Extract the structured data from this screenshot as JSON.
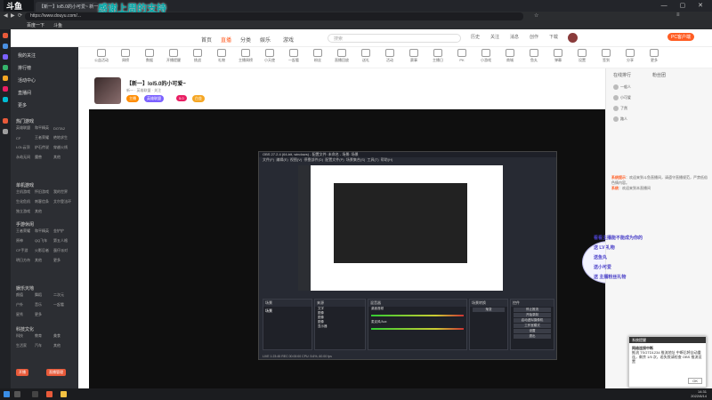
{
  "browser": {
    "brand": "斗鱼",
    "tabs": [
      {
        "label": "【新一】lol5.0的小可爱~ 新一..."
      },
      {
        "label": "新标签页"
      }
    ],
    "address": "https://www.douyu.com/...",
    "banner_text": "感谢上周的支持",
    "bookmarks": [
      "百度一下",
      "斗鱼"
    ]
  },
  "site": {
    "nav": [
      "首页",
      "直播",
      "分类",
      "娱乐",
      "游戏",
      "鱼吧"
    ],
    "active_nav": "直播",
    "search_placeholder": "搜索",
    "header_icons": [
      "历史",
      "关注",
      "消息",
      "创作",
      "下载",
      "开播"
    ],
    "categories": [
      "公益活动",
      "周榜",
      "数据",
      "开播提醒",
      "挑战",
      "礼物",
      "主播周榜",
      "小天使",
      "一起看",
      "粉丝",
      "直播回放",
      "送礼",
      "活动",
      "赛事",
      "主播日",
      "PK",
      "小游戏",
      "商城",
      "鱼丸",
      "弹幕",
      "设置",
      "签到",
      "分享",
      "更多"
    ],
    "pc_badge": "PC客户端",
    "date_badge": "12"
  },
  "sidebar": {
    "main": [
      "我的关注",
      "排行榜",
      "活动中心",
      "直播间",
      "更多"
    ],
    "section1": "热门游戏",
    "grid1": [
      "英雄联盟",
      "和平精英",
      "DOTA2",
      "CF",
      "王者荣耀",
      "绝地求生",
      "LOL云顶",
      "炉石传说",
      "穿越火线",
      "永劫无间",
      "魔兽",
      "其他"
    ],
    "section2": "单机游戏",
    "grid2": [
      "主机游戏",
      "怀旧游戏",
      "我的世界",
      "生化危机",
      "刺客信条",
      "艾尔登法环",
      "独立游戏",
      "其他"
    ],
    "section3": "手游休闲",
    "grid3": [
      "王者荣耀",
      "和平精英",
      "金铲铲",
      "原神",
      "QQ飞车",
      "第五人格",
      "CF手游",
      "火影忍者",
      "蛋仔派对",
      "明日方舟",
      "其他",
      "更多"
    ],
    "section4": "娱乐天地",
    "grid4": [
      "颜值",
      "舞蹈",
      "二次元",
      "户外",
      "音乐",
      "一起看",
      "星秀",
      "更多"
    ],
    "section5": "科技文化",
    "grid5": [
      "科技",
      "教育",
      "美食",
      "生活家",
      "汽车",
      "其他"
    ],
    "buttons": [
      "开播",
      "直播管理"
    ]
  },
  "room": {
    "title": "【新一】lol5.0的小可爱~",
    "subtitle": "新一 · 英雄联盟 · 关注",
    "tags": [
      "主播",
      "英雄联盟",
      "5.0",
      "白金"
    ]
  },
  "obs": {
    "title": "OBS 27.2.4 (64-bit, windows) - 配置文件: 未命名 - 场景: 场景",
    "menu": [
      "文件(F)",
      "编辑(E)",
      "视图(V)",
      "停靠部件(D)",
      "配置文件(P)",
      "场景集合(S)",
      "工具(T)",
      "帮助(H)"
    ],
    "docks": [
      "场景",
      "来源",
      "混音器",
      "场景转换",
      "控件"
    ],
    "scene": "场景",
    "sources": [
      "文字",
      "图像",
      "图像",
      "图像",
      "显示器"
    ],
    "mixer": [
      "桌面音频",
      "麦克风/Aux"
    ],
    "transition": "渐变",
    "controls": [
      "停止推流",
      "开始录制",
      "启动虚拟摄像机",
      "工作室模式",
      "设置",
      "退出"
    ],
    "status": "LIVE 1:23:45  REC 00:00:00  CPU: 5.6%, 60.00 fps"
  },
  "chat": {
    "tabs": [
      "在线排行",
      "粉丝团"
    ],
    "ranks": [
      "一般人",
      "小可爱",
      "了然",
      "路人"
    ],
    "messages": [
      {
        "user": "系统提示",
        "text": "欢迎来到斗鱼直播间，请遵守直播规范，严禁低俗色情内容。"
      },
      {
        "user": "系统",
        "text": "欢迎来到本直播间"
      }
    ]
  },
  "mascot_text": [
    "看看主播能不能成为你的",
    "送 LV 礼物",
    "送鱼丸",
    "送小可爱",
    "送 主播粉丝礼物"
  ],
  "popup": {
    "title": "系统提醒",
    "heading": "网络连接中断",
    "body": "推流 TSGTD1234 推流地址 中断后将自动重连，剩余 1/5 次，若失败请检查 OBS 推流设置",
    "ok": "OK"
  },
  "taskbar": {
    "time": "14:31",
    "date": "2022/8/14"
  },
  "colors": {
    "accent": "#ff5d23",
    "sidebar_bg": "#2c2e33",
    "obs_bg": "#272a33"
  }
}
